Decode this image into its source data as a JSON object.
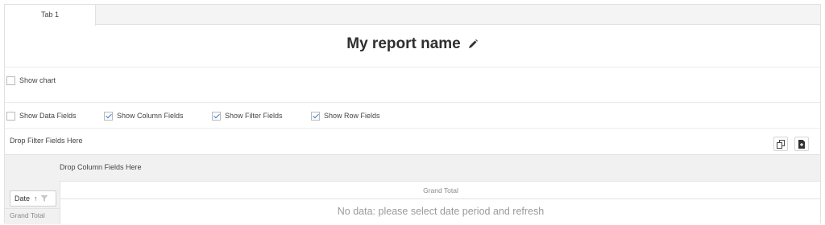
{
  "tabs": [
    {
      "label": "Tab 1"
    }
  ],
  "report": {
    "title": "My report name"
  },
  "options": {
    "show_chart": {
      "label": "Show chart",
      "checked": false
    },
    "fields": [
      {
        "label": "Show Data Fields",
        "checked": false
      },
      {
        "label": "Show Column Fields",
        "checked": true
      },
      {
        "label": "Show Filter Fields",
        "checked": true
      },
      {
        "label": "Show Row Fields",
        "checked": true
      }
    ]
  },
  "filter": {
    "drop_label": "Drop Filter Fields Here"
  },
  "toolbar": {
    "icons": [
      "copy-icon",
      "export-file-icon"
    ]
  },
  "grid": {
    "column_drop_label": "Drop Column Fields Here",
    "grand_total_header": "Grand Total",
    "row_field": {
      "label": "Date",
      "sort": "↑"
    },
    "grand_total_row": "Grand Total",
    "empty_message": "No data: please select date period and refresh"
  },
  "colors": {
    "accent": "#3a7bd5",
    "border": "#e2e2e2",
    "grid_bg": "#f1f1f1"
  }
}
